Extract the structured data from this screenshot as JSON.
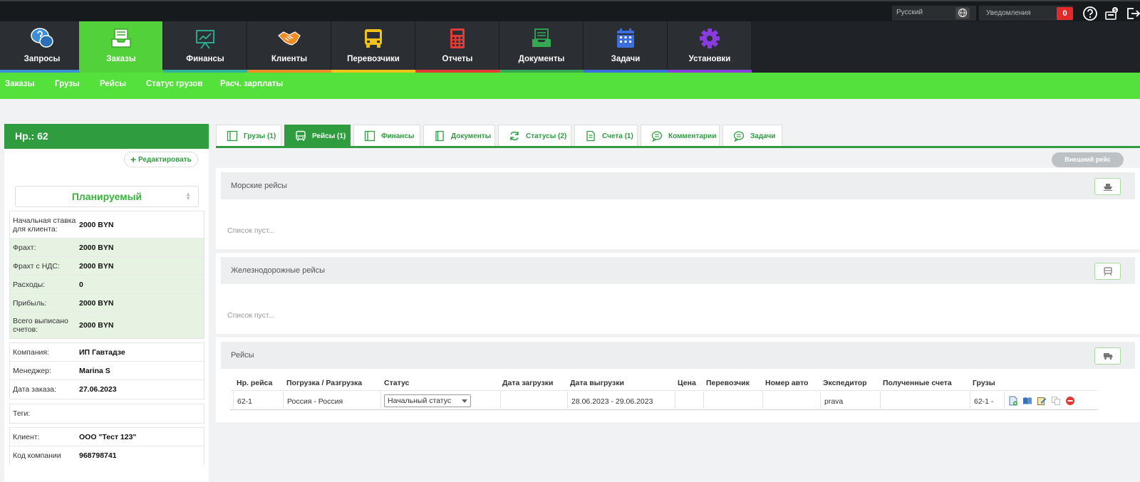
{
  "topbar": {
    "language": "Русский",
    "notifications_label": "Уведомления",
    "notifications_count": "0",
    "help_icon": "help-icon",
    "messages_icon": "messages-icon",
    "logout_icon": "logout-icon"
  },
  "nav": [
    {
      "label": "Запросы",
      "icon": "speech-bubbles-icon",
      "bar_color": "#3b8fd9",
      "active": false
    },
    {
      "label": "Заказы",
      "icon": "tray-documents-icon",
      "bar_color": "#52d13b",
      "active": true
    },
    {
      "label": "Финансы",
      "icon": "presentation-chart-icon",
      "bar_color": "#2fb39a",
      "active": false
    },
    {
      "label": "Клиенты",
      "icon": "handshake-icon",
      "bar_color": "#f08c24",
      "active": false
    },
    {
      "label": "Перевозчики",
      "icon": "truck-icon",
      "bar_color": "#f2c21b",
      "active": false
    },
    {
      "label": "Отчеты",
      "icon": "calculator-icon",
      "bar_color": "#e23a34",
      "active": false
    },
    {
      "label": "Документы",
      "icon": "tray-document-icon",
      "bar_color": "#34a853",
      "active": false
    },
    {
      "label": "Задачи",
      "icon": "calendar-icon",
      "bar_color": "#3b6fe0",
      "active": false
    },
    {
      "label": "Установки",
      "icon": "gear-icon",
      "bar_color": "#8a3be0",
      "active": false
    }
  ],
  "subnav": [
    "Заказы",
    "Грузы",
    "Рейсы",
    "Статус грузов",
    "Расч. зарплаты"
  ],
  "order": {
    "number": "Нр.: 62",
    "edit_label": "Редактировать",
    "status": "Планируемый",
    "financials": [
      {
        "label": "Начальная ставка для клиента:",
        "value": "2000 BYN"
      },
      {
        "label": "Фрахт:",
        "value": "2000 BYN"
      },
      {
        "label": "Фрахт с НДС:",
        "value": "2000 BYN"
      },
      {
        "label": "Расходы:",
        "value": "0"
      },
      {
        "label": "Прибыль:",
        "value": "2000 BYN"
      },
      {
        "label": "Всего выписано счетов:",
        "value": "2000 BYN"
      }
    ],
    "details": [
      {
        "label": "Компания:",
        "value": "ИП Гавтадзе"
      },
      {
        "label": "Менеджер:",
        "value": "Marina S"
      },
      {
        "label": "Дата заказа:",
        "value": "27.06.2023"
      }
    ],
    "tags_label": "Теги:",
    "client": [
      {
        "label": "Клиент:",
        "value": "ООО \"Тест 123\""
      },
      {
        "label": "Код компании",
        "value": "968798741"
      }
    ]
  },
  "tabs": [
    {
      "label": "Грузы (1)",
      "icon": "box-icon",
      "active": false
    },
    {
      "label": "Рейсы (1)",
      "icon": "bus-icon",
      "active": true
    },
    {
      "label": "Финансы",
      "icon": "box-icon",
      "active": false
    },
    {
      "label": "Документы",
      "icon": "document-icon",
      "active": false
    },
    {
      "label": "Статусы (2)",
      "icon": "refresh-icon",
      "active": false
    },
    {
      "label": "Счета (1)",
      "icon": "invoice-icon",
      "active": false
    },
    {
      "label": "Комментарии",
      "icon": "comment-icon",
      "active": false
    },
    {
      "label": "Задачи",
      "icon": "comment-icon",
      "active": false
    }
  ],
  "external_trip_label": "Внешний рейс",
  "sea": {
    "title": "Морские рейсы",
    "empty": "Список пуст...",
    "button_icon": "ship-icon"
  },
  "rail": {
    "title": "Железнодорожные рейсы",
    "empty": "Список пуст...",
    "button_icon": "train-icon"
  },
  "trips": {
    "title": "Рейсы",
    "button_icon": "truck-icon",
    "columns": [
      "Нр. рейса",
      "Погрузка / Разгрузка",
      "Статус",
      "Дата загрузки",
      "Дата выгрузки",
      "Цена",
      "Перевозчик",
      "Номер авто",
      "Экспедитор",
      "Полученные счета",
      "Грузы"
    ],
    "rows": [
      {
        "number": "62-1",
        "route": "Россия - Россия",
        "status": "Начальный статус",
        "load_date": "",
        "unload_date": "28.06.2023 - 29.06.2023",
        "price": "",
        "carrier": "",
        "plate": "",
        "forwarder": "prava",
        "invoices": "",
        "cargo": "62-1 -"
      }
    ],
    "row_actions": [
      "add-document-icon",
      "book-icon",
      "edit-icon",
      "copy-icon",
      "delete-icon"
    ]
  }
}
